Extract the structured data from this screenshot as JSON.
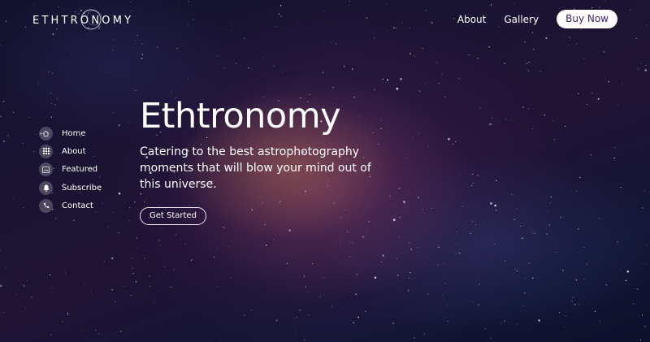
{
  "brand": {
    "logo_text": "ETHTRONOMY"
  },
  "topnav": {
    "links": [
      "About",
      "Gallery"
    ],
    "buy_label": "Buy Now"
  },
  "sidenav": {
    "items": [
      {
        "label": "Home",
        "icon": "home-icon"
      },
      {
        "label": "About",
        "icon": "grid-icon"
      },
      {
        "label": "Featured",
        "icon": "gallery-icon"
      },
      {
        "label": "Subscribe",
        "icon": "bell-icon"
      },
      {
        "label": "Contact",
        "icon": "phone-icon"
      }
    ]
  },
  "hero": {
    "title": "Ethtronomy",
    "subtitle": "Catering to the best astrophotography moments that will blow your mind out of this universe.",
    "cta_label": "Get Started"
  },
  "colors": {
    "accent": "#3b1f66",
    "text": "#ffffff",
    "icon_bg": "rgba(255,255,255,0.22)"
  }
}
